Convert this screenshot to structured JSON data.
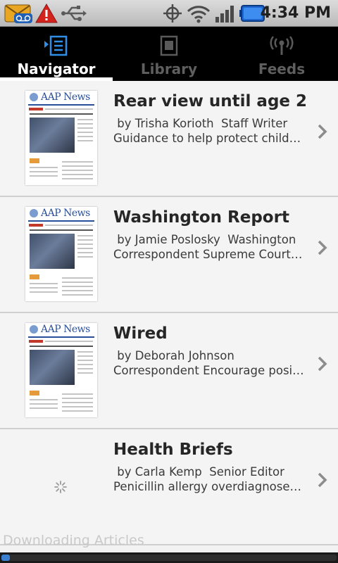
{
  "status_bar": {
    "time": "4:34 PM",
    "icons": [
      "voicemail-icon",
      "warning-icon",
      "usb-icon",
      "gps-icon",
      "wifi-icon",
      "signal-icon",
      "battery-icon"
    ]
  },
  "tabs": [
    {
      "label": "Navigator",
      "icon": "navigator-icon",
      "active": true
    },
    {
      "label": "Library",
      "icon": "library-icon",
      "active": false
    },
    {
      "label": "Feeds",
      "icon": "feeds-icon",
      "active": false
    }
  ],
  "articles": [
    {
      "title": "Rear view until age 2",
      "byline": " by Trisha Korioth  Staff Writer",
      "description": "Guidance to help protect children in motor vehicle crashes",
      "thumbnail": "AAP News"
    },
    {
      "title": "Washington Report",
      "byline": " by Jamie Poslosky  Washington",
      "description": "Correspondent Supreme Court to hear health reform case",
      "thumbnail": "AAP News"
    },
    {
      "title": "Wired",
      "byline": " by Deborah Johnson",
      "description": "Correspondent Encourage positive social media use",
      "thumbnail": "AAP News"
    },
    {
      "title": "Health Briefs",
      "byline": " by Carla Kemp  Senior Editor",
      "description": "Penicillin allergy overdiagnosed in children",
      "thumbnail": ""
    }
  ],
  "download": {
    "status": "Downloading Articles",
    "progress": 0.02
  },
  "colors": {
    "tab_background": "#000000",
    "tab_active": "#ffffff",
    "tab_inactive": "#5f5f5f",
    "progress_fill": "#3a7fd0"
  }
}
